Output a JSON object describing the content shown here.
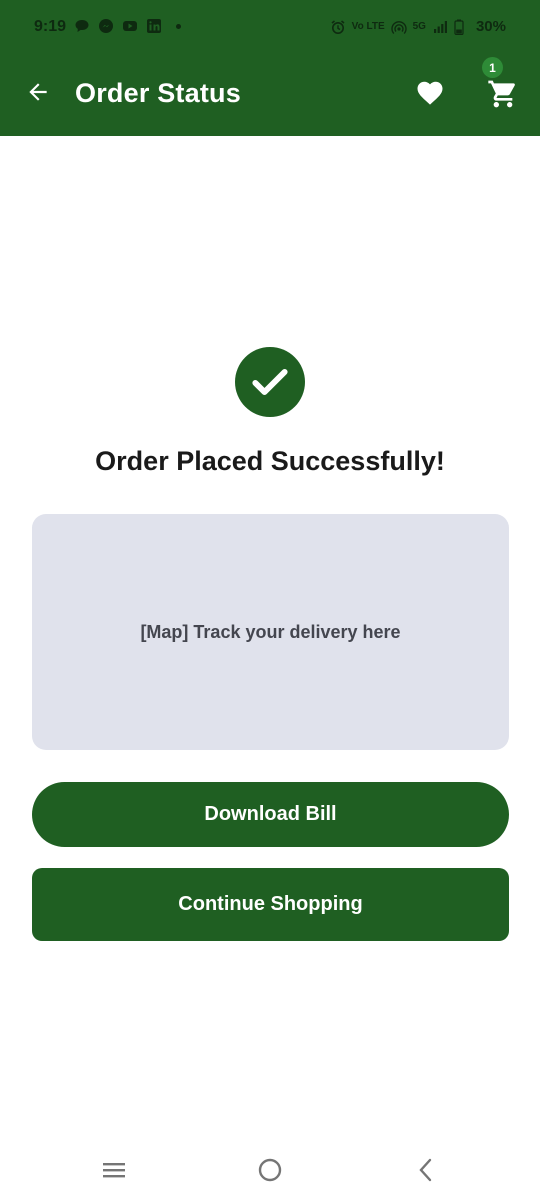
{
  "status_bar": {
    "time": "9:19",
    "left_icons": [
      "chat-bubble-icon",
      "messenger-icon",
      "youtube-icon",
      "linkedin-icon"
    ],
    "right_icons": [
      "alarm-icon",
      "volte-icon",
      "hotspot-icon",
      "signal-icon",
      "battery-icon"
    ],
    "network": "5G",
    "volte": "Vo LTE",
    "battery": "30%"
  },
  "app_bar": {
    "title": "Order Status",
    "back_icon": "arrow-left-icon",
    "favorite_icon": "heart-icon",
    "cart_icon": "shopping-cart-icon",
    "cart_count": "1"
  },
  "main": {
    "success_icon": "check-circle-icon",
    "success_message": "Order Placed Successfully!",
    "map_placeholder": "[Map] Track your delivery here",
    "download_bill_label": "Download Bill",
    "continue_shopping_label": "Continue Shopping"
  },
  "nav_bar": {
    "items": [
      "menu-icon",
      "home-circle-icon",
      "back-chevron-icon"
    ]
  },
  "colors": {
    "primary": "#1f5f22",
    "badge": "#2e8b37",
    "map_background": "#e0e2ec",
    "text_dark": "#1a1a1a"
  }
}
